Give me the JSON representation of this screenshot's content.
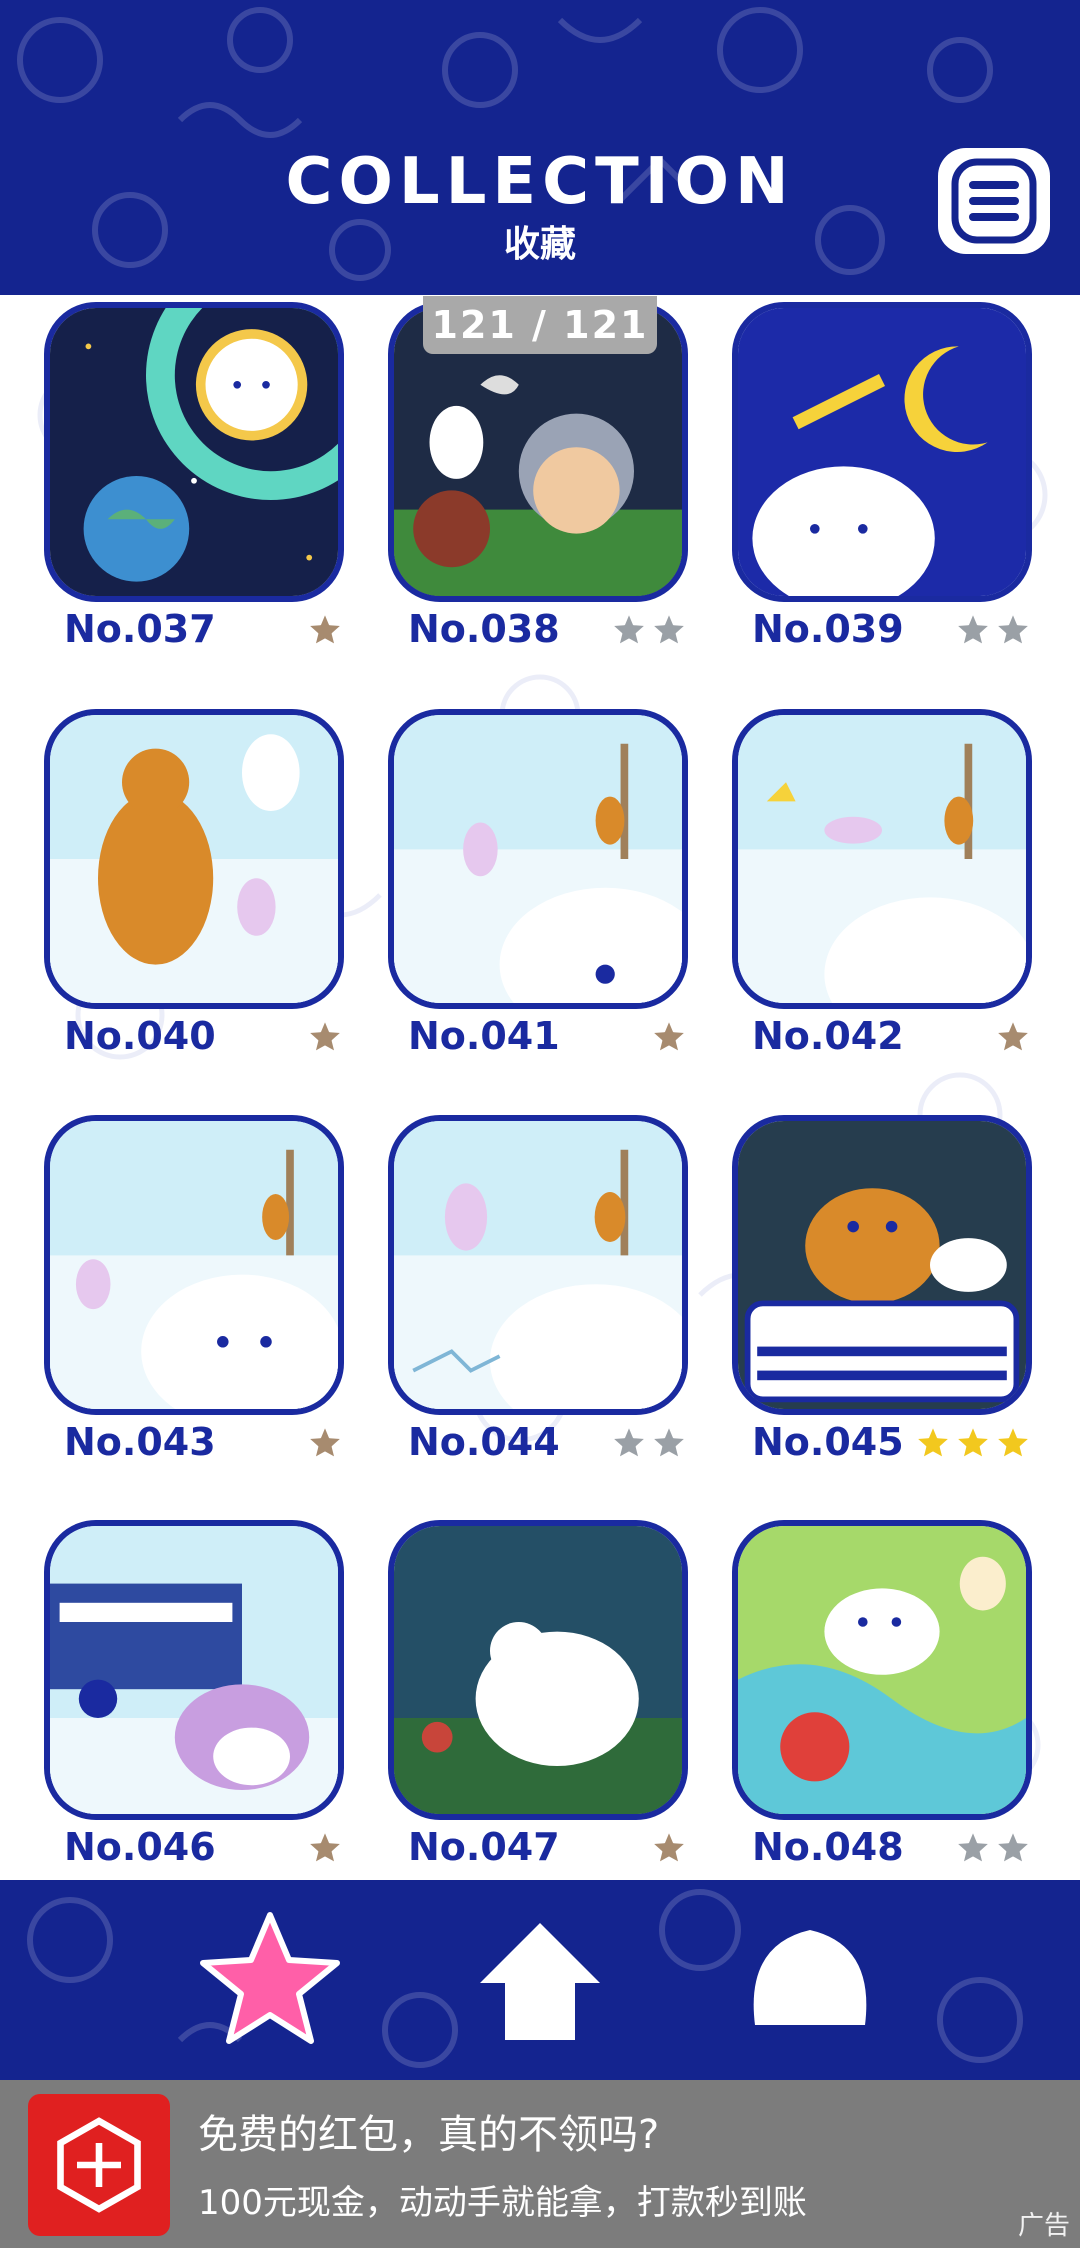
{
  "header": {
    "title": "COLLECTION",
    "subtitle": "收藏",
    "menu_icon": "hamburger-menu-icon"
  },
  "counter": "121 / 121",
  "cards": [
    {
      "label": "No.037",
      "stars": 1,
      "star_color": "#a78b6f"
    },
    {
      "label": "No.038",
      "stars": 2,
      "star_color": "#9aa0a6"
    },
    {
      "label": "No.039",
      "stars": 2,
      "star_color": "#9aa0a6"
    },
    {
      "label": "No.040",
      "stars": 1,
      "star_color": "#a78b6f"
    },
    {
      "label": "No.041",
      "stars": 1,
      "star_color": "#a78b6f"
    },
    {
      "label": "No.042",
      "stars": 1,
      "star_color": "#a78b6f"
    },
    {
      "label": "No.043",
      "stars": 1,
      "star_color": "#a78b6f"
    },
    {
      "label": "No.044",
      "stars": 2,
      "star_color": "#9aa0a6"
    },
    {
      "label": "No.045",
      "stars": 3,
      "star_color": "#f2c81e"
    },
    {
      "label": "No.046",
      "stars": 1,
      "star_color": "#a78b6f"
    },
    {
      "label": "No.047",
      "stars": 1,
      "star_color": "#a78b6f"
    },
    {
      "label": "No.048",
      "stars": 2,
      "star_color": "#9aa0a6"
    }
  ],
  "nav": [
    {
      "name": "star-nav-icon",
      "color": "#ff5fa8"
    },
    {
      "name": "home-nav-icon",
      "color": "#ffffff"
    },
    {
      "name": "character-nav-icon",
      "color": "#ffffff"
    }
  ],
  "ad": {
    "title": "免费的红包，真的不领吗?",
    "subtitle": "100元现金，动动手就能拿，打款秒到账",
    "tag": "广告",
    "icon": "pinduoduo-app-icon"
  },
  "colors": {
    "brand_blue": "#14248f",
    "border_blue": "#1a2aa0"
  }
}
